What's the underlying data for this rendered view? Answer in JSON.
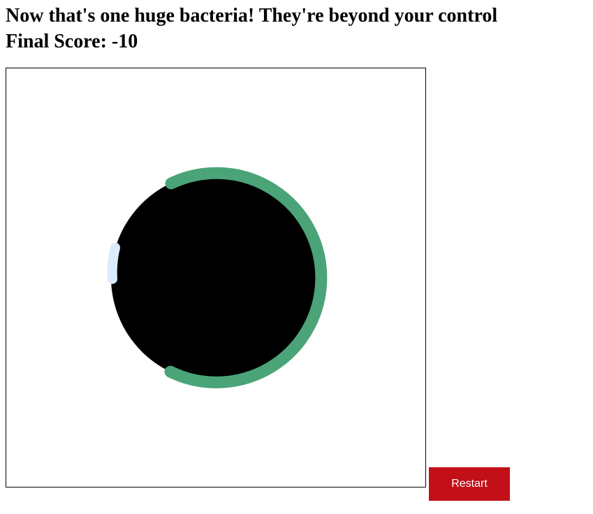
{
  "game": {
    "message": "Now that's one huge bacteria! They're beyond your control",
    "score_line": "Final Score: -10"
  },
  "controls": {
    "restart_label": "Restart"
  },
  "colors": {
    "disk": "#000000",
    "bacteria_large": "#4aa477",
    "bacteria_small": "#dcebfb",
    "restart_button": "#c20f18",
    "canvas_border": "#000000"
  }
}
